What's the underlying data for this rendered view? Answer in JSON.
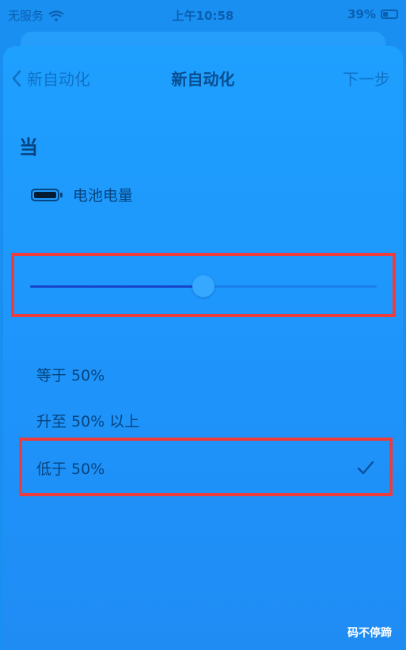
{
  "status_bar": {
    "carrier": "无服务",
    "time": "上午10:58",
    "battery": "39%"
  },
  "nav": {
    "back_label": "新自动化",
    "title": "新自动化",
    "next_label": "下一步"
  },
  "section": {
    "title": "当"
  },
  "trigger": {
    "label": "电池电量",
    "icon": "battery-icon"
  },
  "slider": {
    "value_percent": 50
  },
  "options": [
    {
      "label": "等于 50%"
    },
    {
      "label": "升至 50% 以上"
    },
    {
      "label": "低于 50%",
      "checked": true
    }
  ],
  "watermark": "码不停蹄",
  "colors": {
    "background": "#1a8ff2",
    "highlight": "#ee3b3b",
    "slider_fill": "#1646c8",
    "text": "#07447e"
  }
}
